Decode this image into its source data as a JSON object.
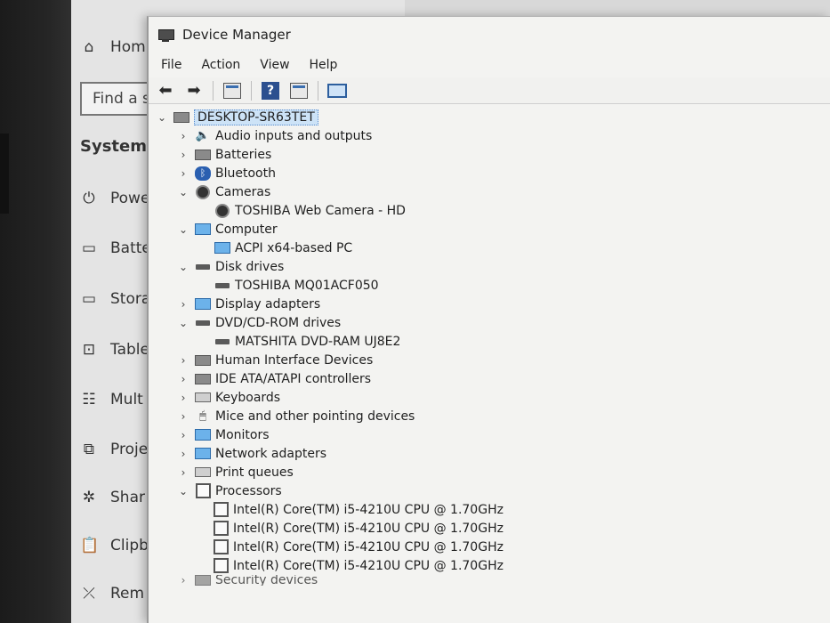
{
  "settings": {
    "find_label": "Find a s",
    "system_label": "System",
    "nav": [
      {
        "label": "Hom",
        "icon": "home-icon"
      },
      {
        "label": "Powe",
        "icon": "power-icon"
      },
      {
        "label": "Batte",
        "icon": "battery-icon"
      },
      {
        "label": "Stora",
        "icon": "storage-icon"
      },
      {
        "label": "Table",
        "icon": "tablet-icon"
      },
      {
        "label": "Mult",
        "icon": "multitasking-icon"
      },
      {
        "label": "Proje",
        "icon": "project-icon"
      },
      {
        "label": "Shar",
        "icon": "share-icon"
      },
      {
        "label": "Clipb",
        "icon": "clipboard-icon"
      },
      {
        "label": "Rem",
        "icon": "remote-icon"
      }
    ]
  },
  "device_manager": {
    "title": "Device Manager",
    "menu": [
      "File",
      "Action",
      "View",
      "Help"
    ],
    "root": "DESKTOP-SR63TET",
    "tree": [
      {
        "label": "Audio inputs and outputs",
        "expanded": false,
        "icon": "speaker-icon"
      },
      {
        "label": "Batteries",
        "expanded": false,
        "icon": "battery-icon"
      },
      {
        "label": "Bluetooth",
        "expanded": false,
        "icon": "bluetooth-icon"
      },
      {
        "label": "Cameras",
        "expanded": true,
        "icon": "camera-icon",
        "children": [
          "TOSHIBA Web Camera - HD"
        ]
      },
      {
        "label": "Computer",
        "expanded": true,
        "icon": "computer-icon",
        "children": [
          "ACPI x64-based PC"
        ]
      },
      {
        "label": "Disk drives",
        "expanded": true,
        "icon": "disk-drive-icon",
        "children": [
          "TOSHIBA MQ01ACF050"
        ]
      },
      {
        "label": "Display adapters",
        "expanded": false,
        "icon": "display-adapter-icon"
      },
      {
        "label": "DVD/CD-ROM drives",
        "expanded": true,
        "icon": "dvd-drive-icon",
        "children": [
          "MATSHITA DVD-RAM UJ8E2"
        ]
      },
      {
        "label": "Human Interface Devices",
        "expanded": false,
        "icon": "hid-icon"
      },
      {
        "label": "IDE ATA/ATAPI controllers",
        "expanded": false,
        "icon": "ide-controller-icon"
      },
      {
        "label": "Keyboards",
        "expanded": false,
        "icon": "keyboard-icon"
      },
      {
        "label": "Mice and other pointing devices",
        "expanded": false,
        "icon": "mouse-icon"
      },
      {
        "label": "Monitors",
        "expanded": false,
        "icon": "monitor-icon"
      },
      {
        "label": "Network adapters",
        "expanded": false,
        "icon": "network-adapter-icon"
      },
      {
        "label": "Print queues",
        "expanded": false,
        "icon": "printer-icon"
      },
      {
        "label": "Processors",
        "expanded": true,
        "icon": "processor-icon",
        "children": [
          "Intel(R) Core(TM) i5-4210U CPU @ 1.70GHz",
          "Intel(R) Core(TM) i5-4210U CPU @ 1.70GHz",
          "Intel(R) Core(TM) i5-4210U CPU @ 1.70GHz",
          "Intel(R) Core(TM) i5-4210U CPU @ 1.70GHz"
        ]
      },
      {
        "label": "Security devices",
        "expanded": false,
        "icon": "security-icon"
      }
    ]
  },
  "colors": {
    "selection": "#cde3f7",
    "accent": "#2b4f8f"
  }
}
